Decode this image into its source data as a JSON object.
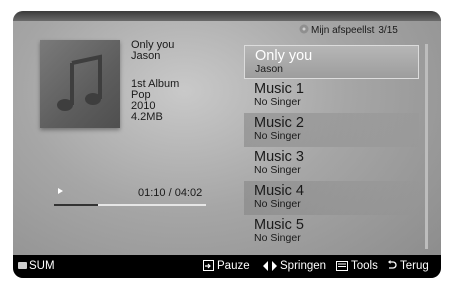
{
  "now_playing": {
    "title": "Only you",
    "artist": "Jason",
    "album": "1st Album",
    "genre": "Pop",
    "year": "2010",
    "size": "4.2MB",
    "time": "01:10 / 04:02",
    "progress": 0.29
  },
  "playlist": {
    "header": "Mijn afspeellst",
    "position": "3/15",
    "items": [
      {
        "title": "Only you",
        "artist": "Jason"
      },
      {
        "title": "Music 1",
        "artist": "No Singer"
      },
      {
        "title": "Music 2",
        "artist": "No Singer"
      },
      {
        "title": "Music 3",
        "artist": "No Singer"
      },
      {
        "title": "Music 4",
        "artist": "No Singer"
      },
      {
        "title": "Music 5",
        "artist": "No Singer"
      }
    ]
  },
  "bottom_bar": {
    "sum": "SUM",
    "pause": "Pauze",
    "skip": "Springen",
    "tools": "Tools",
    "back": "Terug"
  }
}
